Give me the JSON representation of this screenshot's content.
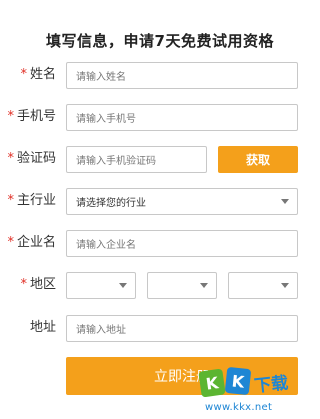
{
  "form": {
    "title": "填写信息，申请7天免费试用资格",
    "required_mark": "*",
    "name": {
      "label": "姓名",
      "placeholder": "请输入姓名"
    },
    "phone": {
      "label": "手机号",
      "placeholder": "请输入手机号"
    },
    "code": {
      "label": "验证码",
      "placeholder": "请输入手机验证码",
      "button": "获取"
    },
    "industry": {
      "label": "主行业",
      "value": "请选择您的行业"
    },
    "company": {
      "label": "企业名",
      "placeholder": "请输入企业名"
    },
    "region": {
      "label": "地区",
      "province": "",
      "city": "",
      "district": ""
    },
    "address": {
      "label": "地址",
      "placeholder": "请输入地址"
    },
    "submit_label": "立即注册"
  },
  "watermark": {
    "logo_k1": "K",
    "logo_k2": "K",
    "logo_text": "下载",
    "url": "www.kkx.net"
  },
  "colors": {
    "accent": "#f4a01b",
    "required": "#e02e24",
    "border": "#c8c8c8",
    "watermark_blue": "#1e86d4",
    "watermark_green": "#5cb531"
  }
}
